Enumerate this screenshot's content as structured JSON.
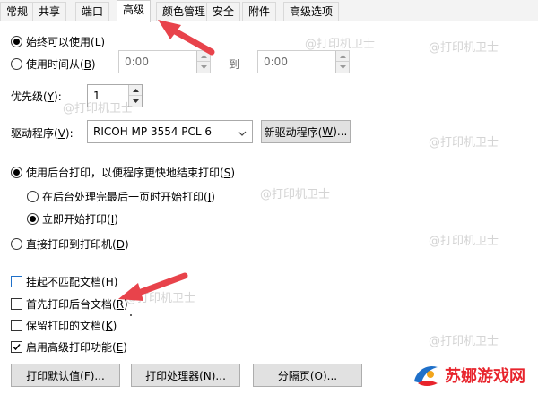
{
  "tabs": [
    {
      "label": "常规"
    },
    {
      "label": "共享"
    },
    {
      "label": "端口"
    },
    {
      "label": "高级"
    },
    {
      "label": "颜色管理"
    },
    {
      "label": "安全"
    },
    {
      "label": "附件"
    },
    {
      "label": "高级选项"
    }
  ],
  "active_tab": "高级",
  "availability": {
    "always_label": "始终可以使用(",
    "always_key": "L",
    "from_label": "使用时间从(",
    "from_key": "B",
    "from_time": "0:00",
    "to_label": "到",
    "to_time": "0:00"
  },
  "priority": {
    "label": "优先级(",
    "key": "Y",
    "value": "1"
  },
  "driver": {
    "label": "驱动程序(",
    "key": "V",
    "selected": "RICOH MP 3554 PCL 6",
    "new_driver_button": "新驱动程序(",
    "new_driver_key": "W"
  },
  "spool": {
    "spool_label": "使用后台打印，以便程序更快地结束打印(",
    "spool_key": "S",
    "after_last_label": "在后台处理完最后一页时开始打印(",
    "after_last_key": "I",
    "immediately_label": "立即开始打印(",
    "immediately_key": "I",
    "direct_label": "直接打印到打印机(",
    "direct_key": "D"
  },
  "options": [
    {
      "label": "挂起不匹配文档(",
      "key": "H",
      "checked": false
    },
    {
      "label": "首先打印后台文档(",
      "key": "R",
      "checked": false
    },
    {
      "label": "保留打印的文档(",
      "key": "K",
      "checked": false
    },
    {
      "label": "启用高级打印功能(",
      "key": "E",
      "checked": true
    }
  ],
  "buttons": {
    "defaults": "打印默认值(F)...",
    "processor": "打印处理器(N)...",
    "separator": "分隔页(O)..."
  },
  "watermark": "@打印机卫士",
  "logo": {
    "text": "苏娜游戏网"
  },
  "colors": {
    "annotation_arrow": "#e8434b",
    "focus_blue": "#1f70c9",
    "logo_red": "#e8242c"
  }
}
